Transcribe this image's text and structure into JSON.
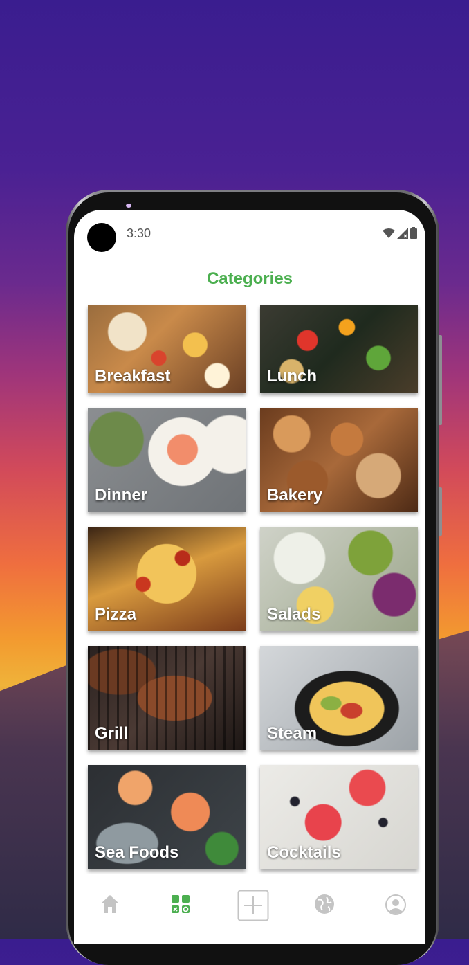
{
  "status_bar": {
    "time": "3:30"
  },
  "page": {
    "title": "Categories"
  },
  "categories": [
    {
      "label": "Breakfast",
      "photo": "breakfast-photo"
    },
    {
      "label": "Lunch",
      "photo": "lunch-photo"
    },
    {
      "label": "Dinner",
      "photo": "dinner-photo"
    },
    {
      "label": "Bakery",
      "photo": "bakery-photo"
    },
    {
      "label": "Pizza",
      "photo": "pizza-photo"
    },
    {
      "label": "Salads",
      "photo": "salads-photo"
    },
    {
      "label": "Grill",
      "photo": "grill-photo"
    },
    {
      "label": "Steam",
      "photo": "steam-photo"
    },
    {
      "label": "Sea Foods",
      "photo": "seafood-photo"
    },
    {
      "label": "Cocktails",
      "photo": "cocktails-photo"
    }
  ],
  "bottom_nav": {
    "items": [
      {
        "icon": "home-icon",
        "active": false
      },
      {
        "icon": "categories-grid-icon",
        "active": true
      },
      {
        "icon": "add-icon",
        "active": false
      },
      {
        "icon": "globe-icon",
        "active": false
      },
      {
        "icon": "profile-icon",
        "active": false
      }
    ],
    "active_color": "#4caf50",
    "inactive_color": "#c4c4c4"
  },
  "colors": {
    "accent": "#4caf50"
  }
}
